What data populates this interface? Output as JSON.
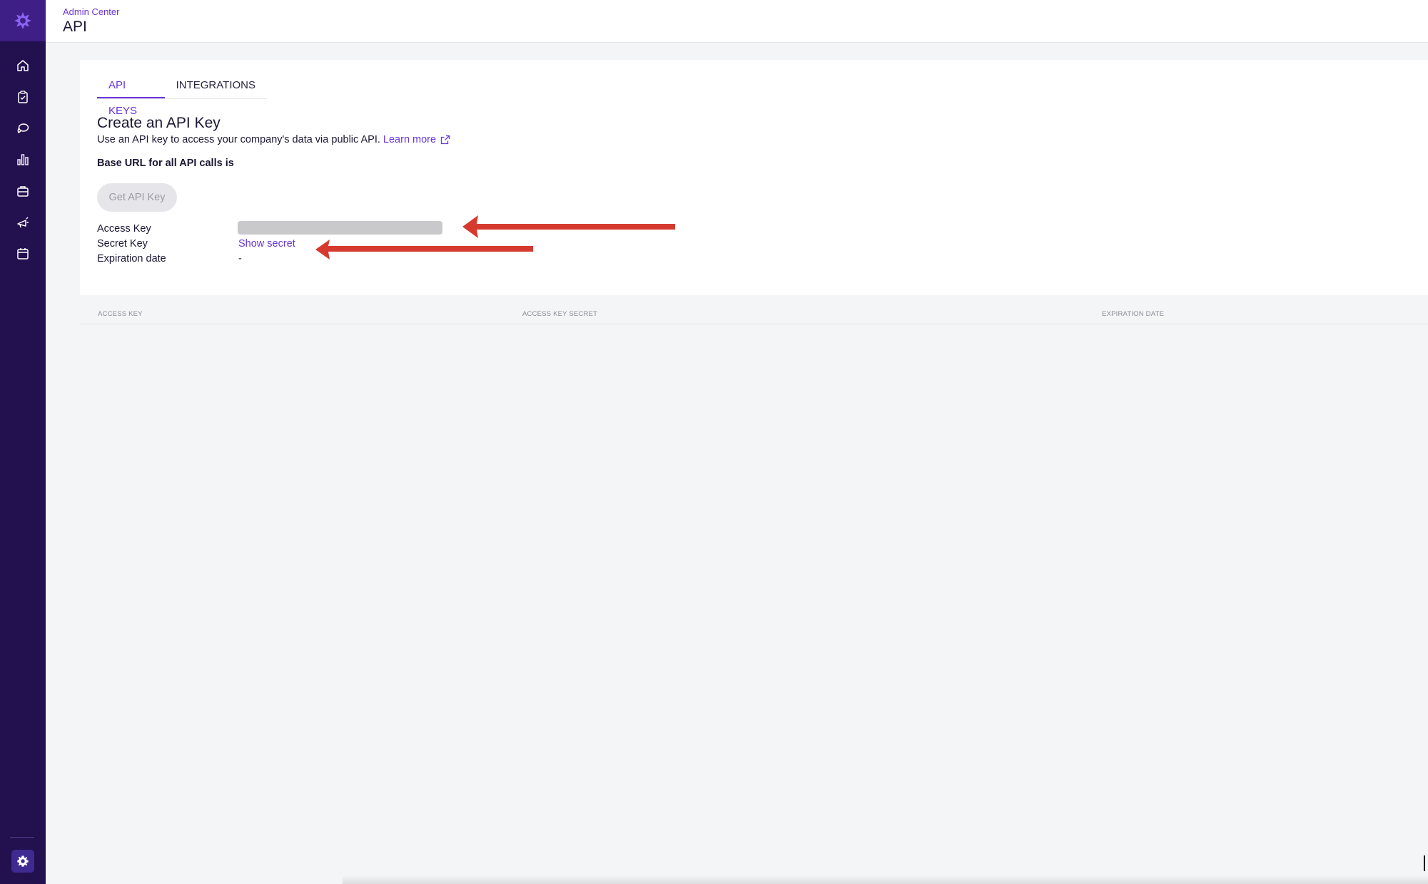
{
  "sidebar": {
    "logo": "brand-logo-icon",
    "items": [
      {
        "name": "home",
        "icon": "home-icon"
      },
      {
        "name": "tasks",
        "icon": "clipboard-check-icon"
      },
      {
        "name": "feedback",
        "icon": "chat-bubbles-icon"
      },
      {
        "name": "analytics",
        "icon": "bar-chart-icon"
      },
      {
        "name": "jobs",
        "icon": "briefcase-icon"
      },
      {
        "name": "engagement",
        "icon": "megaphone-icon"
      },
      {
        "name": "calendar",
        "icon": "calendar-icon"
      }
    ],
    "settings_icon": "gear-icon"
  },
  "header": {
    "breadcrumb": "Admin Center",
    "title": "API"
  },
  "tabs": [
    {
      "label": "API KEYS",
      "active": true
    },
    {
      "label": "INTEGRATIONS",
      "active": false
    }
  ],
  "section": {
    "title": "Create an API Key",
    "subtitle": "Use an API key to access your company's data via public API.",
    "learn_more": "Learn more",
    "base_url_label": "Base URL for all API calls is",
    "get_key_button": "Get API Key"
  },
  "fields": {
    "access_key_label": "Access Key",
    "secret_key_label": "Secret Key",
    "secret_key_action": "Show secret",
    "expiration_label": "Expiration date",
    "expiration_value": "-"
  },
  "table": {
    "columns": [
      "ACCESS KEY",
      "ACCESS KEY SECRET",
      "EXPIRATION DATE"
    ]
  },
  "colors": {
    "sidebar": "#23104f",
    "accent": "#6a35d6",
    "annotation_arrow": "#d63a2f"
  }
}
